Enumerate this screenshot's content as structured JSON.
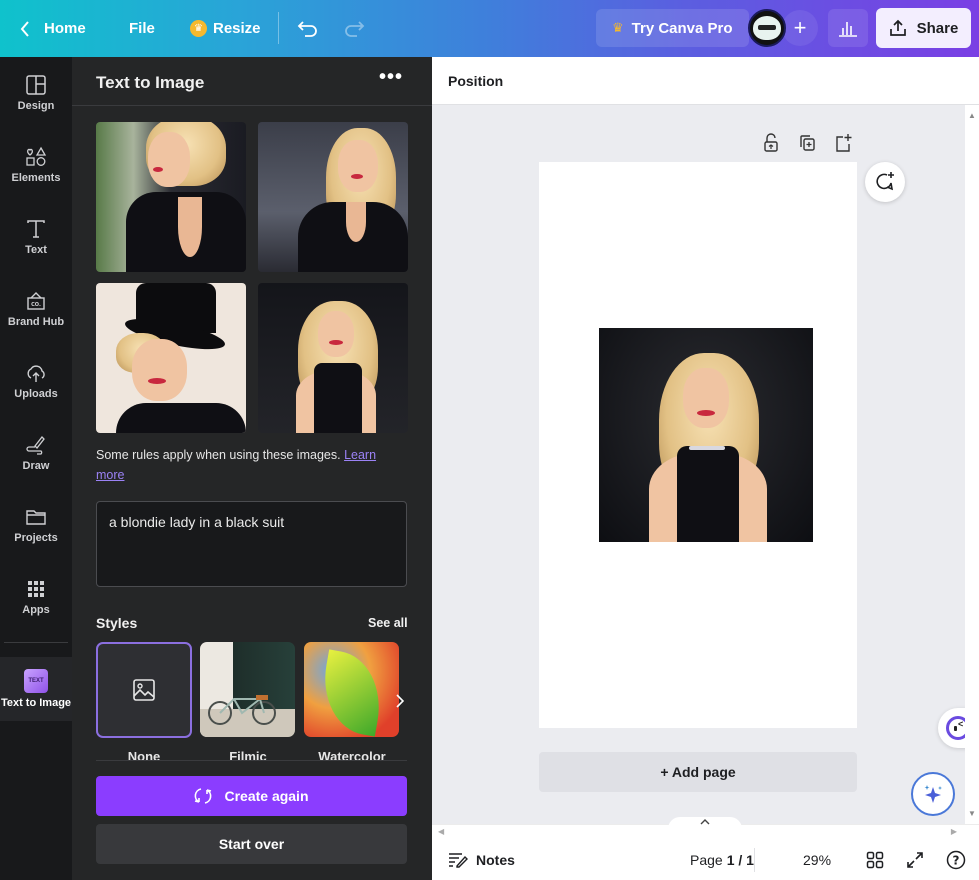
{
  "topbar": {
    "home_label": "Home",
    "file_label": "File",
    "resize_label": "Resize",
    "try_pro_label": "Try Canva Pro",
    "share_label": "Share",
    "add_label": "+"
  },
  "sidebar": {
    "items": [
      {
        "label": "Design",
        "icon": "layout-icon"
      },
      {
        "label": "Elements",
        "icon": "shapes-icon"
      },
      {
        "label": "Text",
        "icon": "text-icon"
      },
      {
        "label": "Brand Hub",
        "icon": "brand-icon"
      },
      {
        "label": "Uploads",
        "icon": "cloud-upload-icon"
      },
      {
        "label": "Draw",
        "icon": "pen-icon"
      },
      {
        "label": "Projects",
        "icon": "folder-icon"
      },
      {
        "label": "Apps",
        "icon": "apps-grid-icon"
      },
      {
        "label": "Text to Image",
        "icon": "text-to-image-icon",
        "active": true
      }
    ],
    "tti_icon_text": "TEXT"
  },
  "panel": {
    "title": "Text to Image",
    "more_label": "•••",
    "images": [
      {
        "alt": "Blonde woman in black suit, profile"
      },
      {
        "alt": "Blonde woman in black blazer"
      },
      {
        "alt": "Woman in black top hat"
      },
      {
        "alt": "Blonde woman in black halter top"
      }
    ],
    "rules_text": "Some rules apply when using these images. ",
    "learn_more": "Learn more",
    "prompt_value": "a blondie lady in a black suit",
    "styles_label": "Styles",
    "see_all": "See all",
    "styles": [
      {
        "name": "None",
        "selected": true
      },
      {
        "name": "Filmic",
        "selected": false
      },
      {
        "name": "Watercolor",
        "selected": false
      }
    ],
    "create_again": "Create again",
    "start_over": "Start over",
    "accent": "#8b3dff"
  },
  "canvas": {
    "context_label": "Position",
    "add_page": "+ Add page"
  },
  "bottombar": {
    "notes": "Notes",
    "page_label": "Page",
    "page_value": "1 / 1",
    "zoom": "29%",
    "help": "?"
  }
}
